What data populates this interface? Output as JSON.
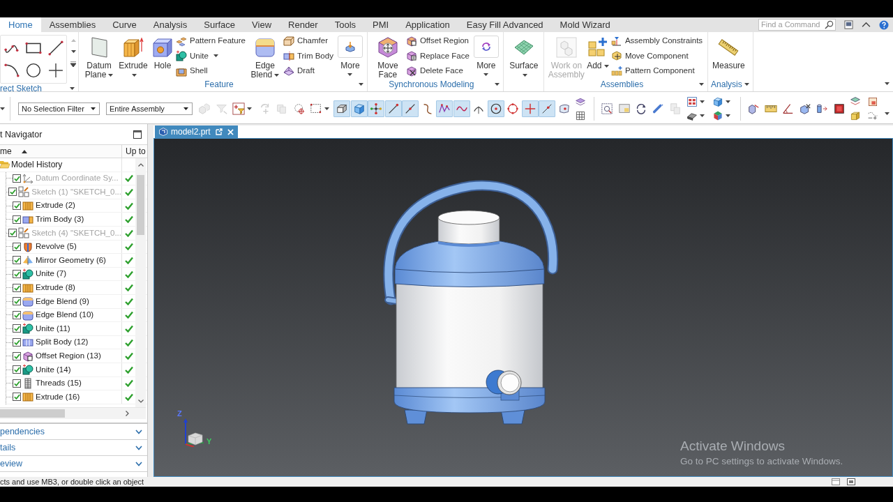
{
  "menu_tabs": [
    {
      "label": "Home",
      "selected": true
    },
    {
      "label": "Assemblies",
      "selected": false
    },
    {
      "label": "Curve",
      "selected": false
    },
    {
      "label": "Analysis",
      "selected": false
    },
    {
      "label": "Surface",
      "selected": false
    },
    {
      "label": "View",
      "selected": false
    },
    {
      "label": "Render",
      "selected": false
    },
    {
      "label": "Tools",
      "selected": false
    },
    {
      "label": "PMI",
      "selected": false
    },
    {
      "label": "Application",
      "selected": false
    },
    {
      "label": "Easy Fill Advanced",
      "selected": false
    },
    {
      "label": "Mold Wizard",
      "selected": false
    }
  ],
  "command_search": {
    "placeholder": "Find a Command"
  },
  "ribbon": {
    "groups": [
      {
        "label": "rect Sketch",
        "kind": "sketch",
        "launcher": true
      },
      {
        "label": "Feature",
        "kind": "commands",
        "launcher": true,
        "items": [
          {
            "kind": "large",
            "label": "Datum Plane",
            "menu": true,
            "disabled": false
          },
          {
            "kind": "large",
            "label": "Extrude",
            "menu": true,
            "disabled": false
          },
          {
            "kind": "large",
            "label": "Hole",
            "menu": false,
            "disabled": false
          },
          {
            "kind": "column",
            "commands": [
              {
                "label": "Pattern Feature",
                "menu": false
              },
              {
                "label": "Unite",
                "menu": true
              },
              {
                "label": "Shell",
                "menu": false
              }
            ]
          },
          {
            "kind": "large",
            "label": "Edge Blend",
            "menu": true,
            "disabled": false
          },
          {
            "kind": "column",
            "commands": [
              {
                "label": "Chamfer",
                "menu": false
              },
              {
                "label": "Trim Body",
                "menu": false
              },
              {
                "label": "Draft",
                "menu": false
              }
            ]
          },
          {
            "kind": "more",
            "label": "More",
            "menu": true,
            "disabled": false
          }
        ]
      },
      {
        "label": "Synchronous Modeling",
        "kind": "commands",
        "launcher": true,
        "items": [
          {
            "kind": "large",
            "label": "Move Face",
            "menu": false,
            "disabled": false
          },
          {
            "kind": "column",
            "commands": [
              {
                "label": "Offset Region",
                "menu": false
              },
              {
                "label": "Replace Face",
                "menu": false
              },
              {
                "label": "Delete Face",
                "menu": false
              }
            ]
          },
          {
            "kind": "more",
            "label": "More",
            "menu": true,
            "disabled": false
          }
        ]
      },
      {
        "kind": "commands",
        "launcher": false,
        "items": [
          {
            "kind": "large",
            "label": "Surface",
            "menu": true,
            "disabled": false
          }
        ]
      },
      {
        "label": "Assemblies",
        "kind": "commands",
        "launcher": true,
        "items": [
          {
            "kind": "large",
            "label": "Work on Assembly",
            "menu": false,
            "disabled": true
          },
          {
            "kind": "large",
            "label": "Add",
            "menu": true,
            "disabled": false
          },
          {
            "kind": "column",
            "commands": [
              {
                "label": "Assembly Constraints",
                "menu": false
              },
              {
                "label": "Move Component",
                "menu": false
              },
              {
                "label": "Pattern Component",
                "menu": false
              }
            ]
          }
        ]
      },
      {
        "label": "Analysis",
        "kind": "commands",
        "launcher": true,
        "items": [
          {
            "kind": "large",
            "label": "Measure",
            "menu": false,
            "disabled": false
          }
        ]
      }
    ]
  },
  "toolbar": {
    "filters": [
      {
        "value": "No Selection Filter"
      },
      {
        "value": "Entire Assembly"
      }
    ],
    "groups": [
      {
        "tools": [
          {
            "kind": "boxes",
            "selected": false,
            "disabled": true,
            "menu": false
          },
          {
            "kind": "funnel",
            "selected": false,
            "disabled": true,
            "menu": false
          },
          {
            "kind": "filter",
            "selected": false,
            "disabled": false,
            "menu": true
          },
          {
            "kind": "rotate",
            "selected": false,
            "disabled": true,
            "menu": false
          },
          {
            "kind": "sheets",
            "selected": false,
            "disabled": true,
            "menu": false
          },
          {
            "kind": "lasso",
            "selected": false,
            "disabled": false,
            "menu": false
          },
          {
            "kind": "marquee",
            "selected": false,
            "disabled": false,
            "menu": true
          }
        ]
      },
      {
        "tools": [
          {
            "kind": "shaded",
            "selected": true,
            "disabled": false,
            "menu": false
          },
          {
            "kind": "cube",
            "selected": true,
            "disabled": false,
            "menu": false
          },
          {
            "kind": "points",
            "selected": true,
            "disabled": false,
            "menu": false
          },
          {
            "kind": "endpoint",
            "selected": true,
            "disabled": false,
            "menu": false
          },
          {
            "kind": "midpoint",
            "selected": true,
            "disabled": false,
            "menu": false
          },
          {
            "kind": "curve",
            "selected": false,
            "disabled": false,
            "menu": false
          },
          {
            "kind": "zigzag",
            "selected": true,
            "disabled": false,
            "menu": false
          },
          {
            "kind": "wave",
            "selected": true,
            "disabled": false,
            "menu": false
          },
          {
            "kind": "arc",
            "selected": false,
            "disabled": false,
            "menu": false
          },
          {
            "kind": "center",
            "selected": true,
            "disabled": false,
            "menu": false
          },
          {
            "kind": "quadrant",
            "selected": false,
            "disabled": false,
            "menu": false
          },
          {
            "kind": "plus",
            "selected": true,
            "disabled": false,
            "menu": false
          },
          {
            "kind": "onpoint",
            "selected": true,
            "disabled": false,
            "menu": false
          },
          {
            "kind": "facepoint",
            "selected": false,
            "disabled": false,
            "menu": false
          },
          {
            "kind": "stack",
            "tools": [
              {
                "kind": "plane",
                "selected": false,
                "disabled": false,
                "menu": false
              },
              {
                "kind": "grid",
                "selected": false,
                "disabled": false,
                "menu": false
              }
            ]
          }
        ]
      },
      {
        "tools": [
          {
            "kind": "zoom",
            "selected": false,
            "disabled": false,
            "menu": false
          },
          {
            "kind": "picture",
            "selected": false,
            "disabled": false,
            "menu": false
          },
          {
            "kind": "orbit",
            "selected": false,
            "disabled": false,
            "menu": false
          },
          {
            "kind": "cylinder",
            "selected": false,
            "disabled": false,
            "menu": false
          },
          {
            "kind": "copies",
            "selected": false,
            "disabled": true,
            "menu": false
          },
          {
            "kind": "stack",
            "tools": [
              {
                "kind": "layout",
                "selected": false,
                "disabled": false,
                "menu": true
              },
              {
                "kind": "shading",
                "selected": false,
                "disabled": false,
                "menu": true
              }
            ]
          },
          {
            "kind": "stack",
            "tools": [
              {
                "kind": "cube",
                "selected": false,
                "disabled": false,
                "menu": true
              },
              {
                "kind": "color",
                "selected": false,
                "disabled": false,
                "menu": true
              }
            ]
          }
        ]
      },
      {
        "tools": [
          {
            "kind": "pen",
            "selected": false,
            "disabled": false,
            "menu": false
          },
          {
            "kind": "ruler",
            "selected": false,
            "disabled": false,
            "menu": false
          },
          {
            "kind": "angle",
            "selected": false,
            "disabled": false,
            "menu": false
          },
          {
            "kind": "section",
            "selected": false,
            "disabled": false,
            "menu": false
          },
          {
            "kind": "extend",
            "selected": false,
            "disabled": false,
            "menu": false
          },
          {
            "kind": "solid",
            "selected": false,
            "disabled": false,
            "menu": false
          },
          {
            "kind": "stack",
            "tools": [
              {
                "kind": "layers",
                "selected": false,
                "disabled": false,
                "menu": false
              },
              {
                "kind": "box",
                "selected": false,
                "disabled": false,
                "menu": false
              }
            ]
          },
          {
            "kind": "stack",
            "tools": [
              {
                "kind": "sheet",
                "selected": false,
                "disabled": false,
                "menu": false
              },
              {
                "kind": "path",
                "selected": false,
                "disabled": false,
                "menu": false
              }
            ]
          }
        ]
      }
    ]
  },
  "navigator": {
    "title": "t Navigator",
    "columns": [
      {
        "label": "me",
        "sorted": true
      },
      {
        "label": "Up to",
        "sorted": false
      }
    ],
    "tree": [
      {
        "label": "Model History",
        "expanded": true,
        "children": [
          {
            "label": "Datum Coordinate Sy...",
            "kind": "datum",
            "checked": true,
            "dimmed": true,
            "up_to_date": true
          },
          {
            "label": "Sketch (1) \"SKETCH_0...",
            "kind": "sketch",
            "checked": true,
            "dimmed": true,
            "up_to_date": true
          },
          {
            "label": "Extrude (2)",
            "kind": "extrude",
            "checked": true,
            "dimmed": false,
            "up_to_date": true
          },
          {
            "label": "Trim Body (3)",
            "kind": "trim",
            "checked": true,
            "dimmed": false,
            "up_to_date": true
          },
          {
            "label": "Sketch (4) \"SKETCH_0...",
            "kind": "sketch",
            "checked": true,
            "dimmed": true,
            "up_to_date": true
          },
          {
            "label": "Revolve (5)",
            "kind": "revolve",
            "checked": true,
            "dimmed": false,
            "up_to_date": true
          },
          {
            "label": "Mirror Geometry (6)",
            "kind": "mirror",
            "checked": true,
            "dimmed": false,
            "up_to_date": true
          },
          {
            "label": "Unite (7)",
            "kind": "unite",
            "checked": true,
            "dimmed": false,
            "up_to_date": true
          },
          {
            "label": "Extrude (8)",
            "kind": "extrude",
            "checked": true,
            "dimmed": false,
            "up_to_date": true
          },
          {
            "label": "Edge Blend (9)",
            "kind": "blend",
            "checked": true,
            "dimmed": false,
            "up_to_date": true
          },
          {
            "label": "Edge Blend (10)",
            "kind": "blend",
            "checked": true,
            "dimmed": false,
            "up_to_date": true
          },
          {
            "label": "Unite (11)",
            "kind": "unite",
            "checked": true,
            "dimmed": false,
            "up_to_date": true
          },
          {
            "label": "Split Body (12)",
            "kind": "split",
            "checked": true,
            "dimmed": false,
            "up_to_date": true
          },
          {
            "label": "Offset Region (13)",
            "kind": "offset",
            "checked": true,
            "dimmed": false,
            "up_to_date": true
          },
          {
            "label": "Unite (14)",
            "kind": "unite",
            "checked": true,
            "dimmed": false,
            "up_to_date": true
          },
          {
            "label": "Threads (15)",
            "kind": "threads",
            "checked": true,
            "dimmed": false,
            "up_to_date": true
          },
          {
            "label": "Extrude (16)",
            "kind": "extrude",
            "checked": true,
            "dimmed": false,
            "up_to_date": true
          }
        ]
      }
    ],
    "sections": [
      {
        "label": "pendencies",
        "expanded": false
      },
      {
        "label": "tails",
        "expanded": false
      },
      {
        "label": "eview",
        "expanded": false
      }
    ]
  },
  "viewport": {
    "tabs": [
      {
        "label": "model2.prt",
        "selected": true
      }
    ],
    "triad": {
      "axes": [
        {
          "label": "Z",
          "color": "#5a78ff"
        },
        {
          "label": "Y",
          "color": "#3cd060"
        }
      ]
    }
  },
  "os_notice": {
    "title": "Activate Windows",
    "message": "Go to PC settings to activate Windows."
  },
  "status_bar": {
    "text": "cts and use MB3, or double click an object"
  }
}
